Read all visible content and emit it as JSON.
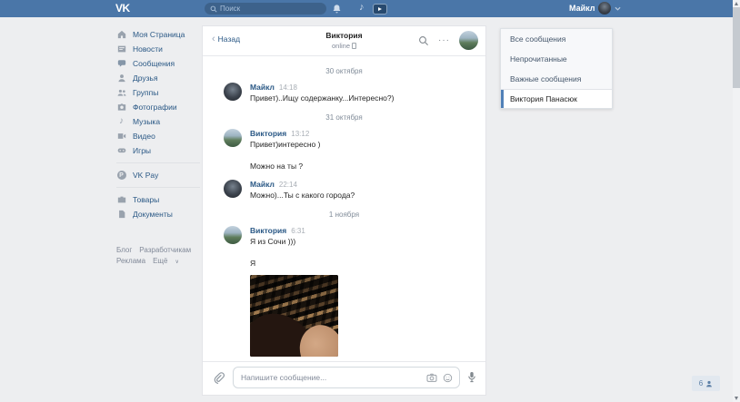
{
  "colors": {
    "vk_blue": "#4a76a8",
    "link_blue": "#2a5885",
    "accent": "#5181b8",
    "page_bg": "#edeef0"
  },
  "glyphs": {
    "music_note": "♪",
    "ellipsis": "···",
    "back_chevron": "‹",
    "vkpay_letter": "P",
    "caret_down": "∨"
  },
  "topbar": {
    "logo_text": "VK",
    "search_placeholder": "Поиск",
    "user_name": "Майкл"
  },
  "sidebar": {
    "items": [
      {
        "label": "Моя Страница"
      },
      {
        "label": "Новости"
      },
      {
        "label": "Сообщения"
      },
      {
        "label": "Друзья"
      },
      {
        "label": "Группы"
      },
      {
        "label": "Фотографии"
      },
      {
        "label": "Музыка"
      },
      {
        "label": "Видео"
      },
      {
        "label": "Игры"
      },
      {
        "label": "VK Pay"
      },
      {
        "label": "Товары"
      },
      {
        "label": "Документы"
      }
    ],
    "footer_links": [
      "Блог",
      "Разработчикам",
      "Реклама",
      "Ещё"
    ]
  },
  "dropdown": {
    "items": [
      "Все сообщения",
      "Непрочитанные",
      "Важные сообщения"
    ],
    "selected": "Виктория Панасюк"
  },
  "chat": {
    "back_label": "Назад",
    "title": "Виктория",
    "status": "online",
    "composer_placeholder": "Напишите сообщение...",
    "days": [
      {
        "date": "30 октября",
        "messages": [
          {
            "author": "Майкл",
            "time": "14:18",
            "lines": [
              "Привет)..Ищу содержанку...Интересно?)"
            ]
          }
        ]
      },
      {
        "date": "31 октября",
        "messages": [
          {
            "author": "Виктория",
            "time": "13:12",
            "lines": [
              "Привет)интересно )",
              "Можно на ты ?"
            ]
          },
          {
            "author": "Майкл",
            "time": "22:14",
            "lines": [
              "Можно)...Ты с какого города?"
            ]
          }
        ]
      },
      {
        "date": "1 ноября",
        "messages": [
          {
            "author": "Виктория",
            "time": "6:31",
            "lines": [
              "Я из Сочи )))",
              "Я"
            ],
            "attachment": "photo"
          }
        ]
      }
    ]
  },
  "footer": {
    "online_friends_count": "6"
  }
}
